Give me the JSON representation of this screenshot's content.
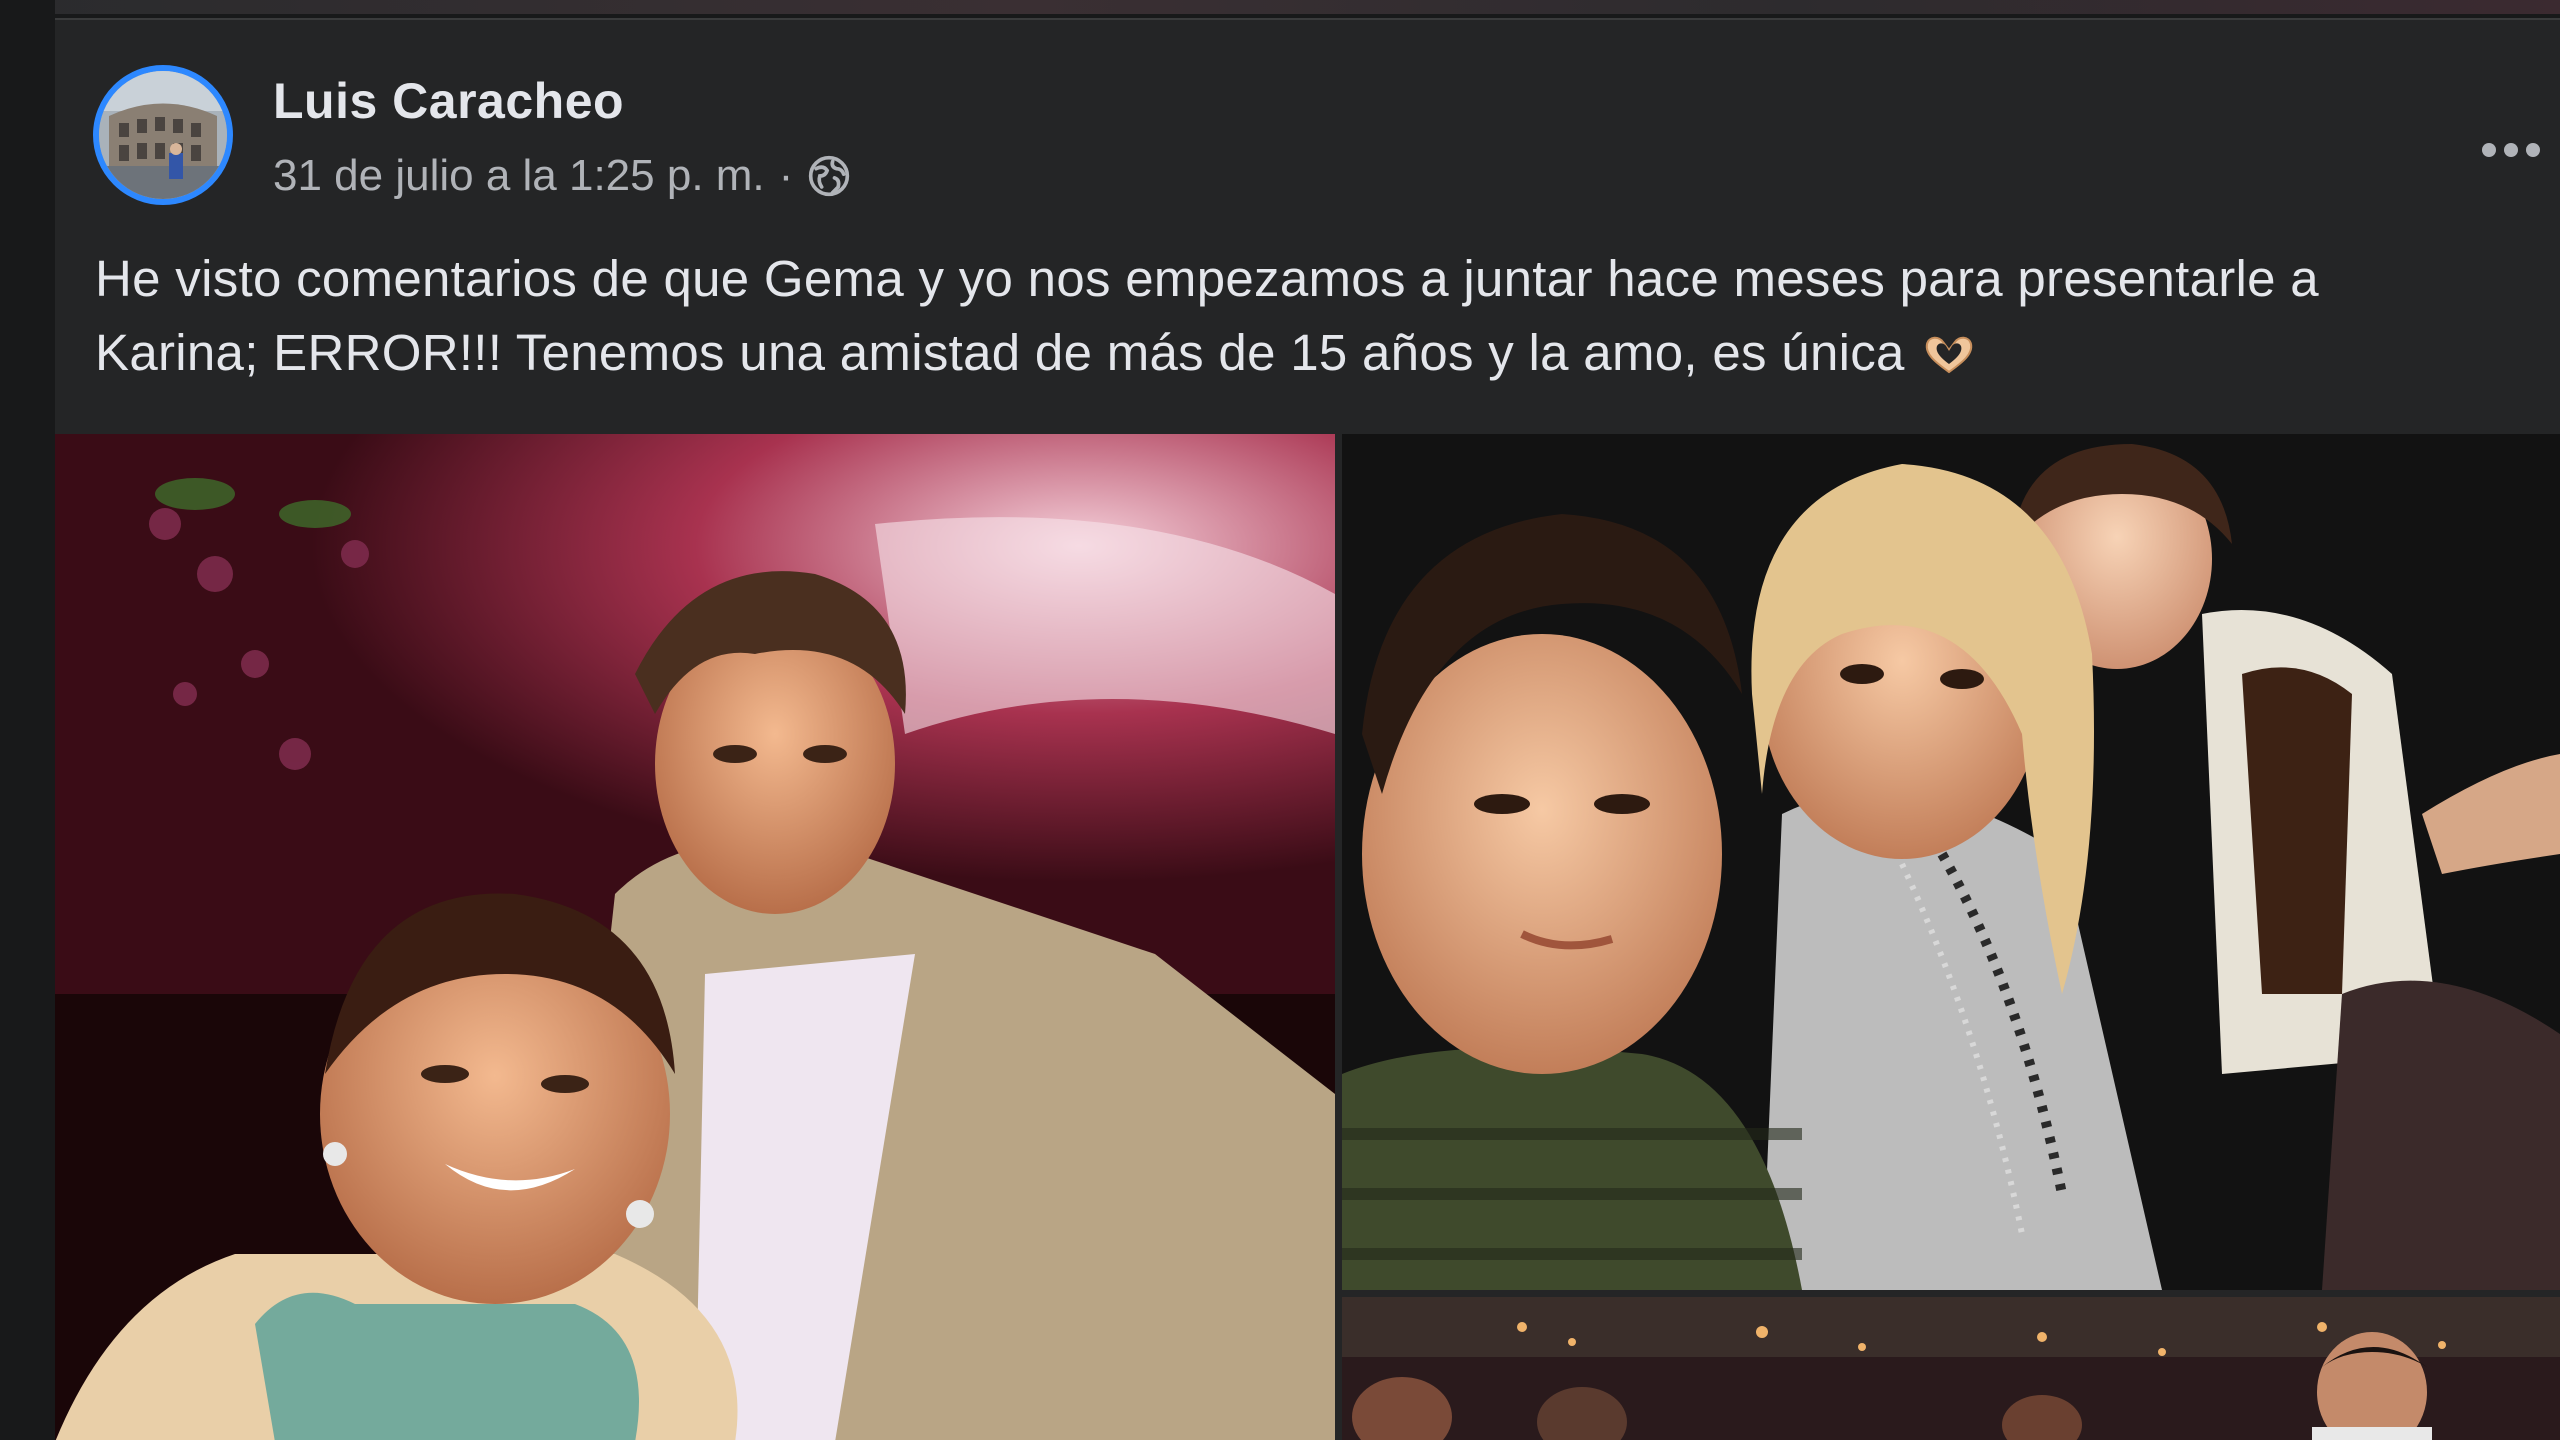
{
  "post": {
    "author": "Luis Caracheo",
    "timestamp": "31 de julio a la 1:25 p. m.",
    "separator": "·",
    "privacy_icon": "globe-icon",
    "avatar_icon": "colosseum-avatar",
    "more_icon": "more-options-icon",
    "text_line_1": "He visto comentarios de que Gema y yo nos empezamos a juntar hace meses para presentarle a",
    "text_line_2": "Karina; ERROR!!! Tenemos una amistad de más de 15 años y la amo, es única",
    "text_emoji": "heart-hands-emoji",
    "photos": [
      {
        "name": "photo-couple-party"
      },
      {
        "name": "photo-three-friends-night"
      },
      {
        "name": "photo-crowd-club"
      }
    ]
  },
  "colors": {
    "background": "#18191a",
    "card": "#242526",
    "text_primary": "#e4e6eb",
    "text_secondary": "#b0b3b8",
    "avatar_ring": "#2d88ff"
  }
}
